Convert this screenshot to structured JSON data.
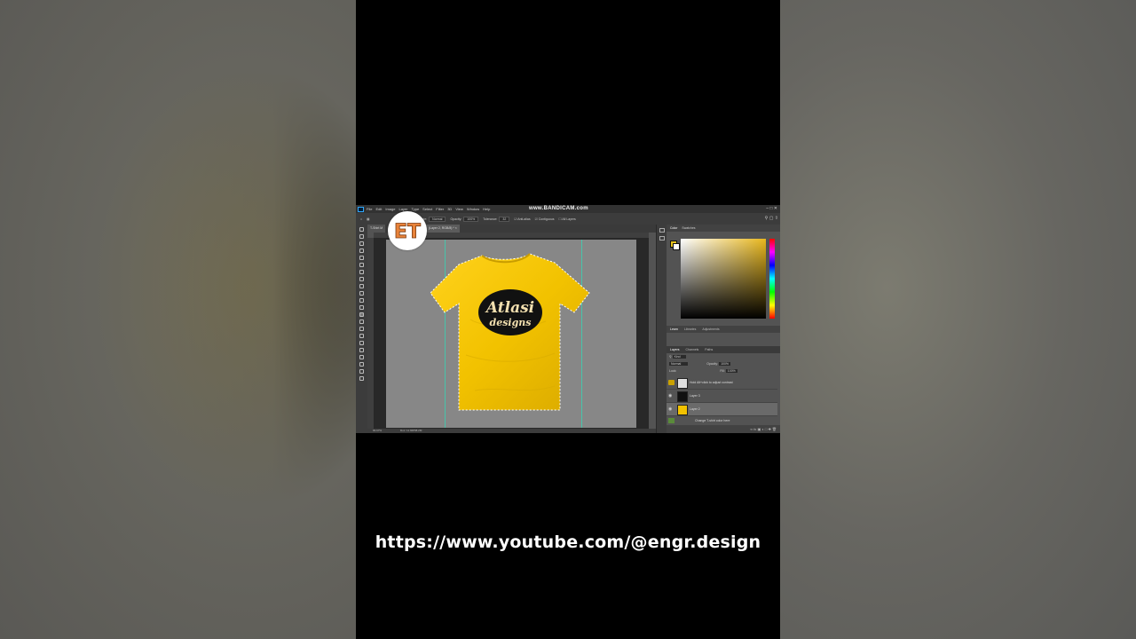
{
  "overlay": {
    "watermark": "www.BANDICAM.com",
    "channel_logo_letters": "ET",
    "link_text": "https://www.youtube.com/@engr.design"
  },
  "menu": {
    "items": [
      "File",
      "Edit",
      "Image",
      "Layer",
      "Type",
      "Select",
      "Filter",
      "3D",
      "View",
      "Window",
      "Help"
    ]
  },
  "options": {
    "mode_label": "Mode:",
    "mode_value": "Normal",
    "opacity_label": "Opacity:",
    "opacity_value": "100%",
    "tolerance_label": "Tolerance:",
    "tolerance_value": "32",
    "antialias": "Anti-alias",
    "contiguous": "Contiguous",
    "all_layers": "All Layers"
  },
  "tabs": [
    {
      "label": "T-Shirt M"
    },
    {
      "label": "(Layer 2, RGB/8) *"
    }
  ],
  "artwork": {
    "line1": "Atlasi",
    "line2": "designs",
    "shirt_color": "#f2c200"
  },
  "status": {
    "zoom": "66.67%",
    "doc": "Doc: 11.9M/58.2M"
  },
  "color_panel": {
    "tabs": [
      "Color",
      "Swatches"
    ],
    "fg_color": "#e6c21b"
  },
  "mid_panel": {
    "tabs": [
      "Learn",
      "Libraries",
      "Adjustments"
    ]
  },
  "layers_panel": {
    "tabs": [
      "Layers",
      "Channels",
      "Paths"
    ],
    "filter_label": "Kind",
    "blend_mode": "Normal",
    "opacity_label": "Opacity:",
    "opacity_value": "100%",
    "lock_label": "Lock:",
    "fill_label": "Fill:",
    "fill_value": "100%",
    "layers": [
      {
        "name": "Hold Alt+click to adjust contrast"
      },
      {
        "name": "Layer 3"
      },
      {
        "name": "Layer 2"
      },
      {
        "name": "Change T-shirt color here"
      }
    ]
  }
}
